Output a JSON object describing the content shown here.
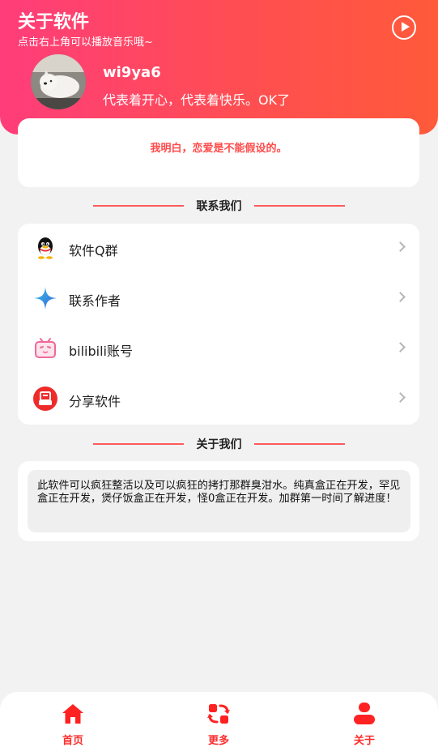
{
  "header": {
    "title": "关于软件",
    "subtitle": "点击右上角可以播放音乐哦~",
    "play_icon": "play-circle-icon"
  },
  "profile": {
    "username": "wi9ya6",
    "tagline": "代表着开心，代表着快乐。OK了"
  },
  "quote": "我明白，恋爱是不能假设的。",
  "contact_section": {
    "title": "联系我们",
    "items": [
      {
        "label": "软件Q群",
        "icon": "qq-penguin-icon"
      },
      {
        "label": "联系作者",
        "icon": "star-sparkle-icon"
      },
      {
        "label": "bilibili账号",
        "icon": "bilibili-tv-icon"
      },
      {
        "label": "分享软件",
        "icon": "share-icon"
      }
    ]
  },
  "about_section": {
    "title": "关于我们",
    "text": "此软件可以疯狂整活以及可以疯狂的拷打那群臭泔水。纯真盒正在开发，罕见盒正在开发，煲仔饭盒正在开发，怪0盒正在开发。加群第一时间了解进度！"
  },
  "bottom_nav": {
    "items": [
      {
        "label": "首页",
        "icon": "home-icon"
      },
      {
        "label": "更多",
        "icon": "refresh-swap-icon"
      },
      {
        "label": "关于",
        "icon": "user-icon"
      }
    ]
  },
  "colors": {
    "accent": "#ff3d3d",
    "header_gradient_start": "#ff3d7a",
    "header_gradient_end": "#ff5a3a"
  }
}
